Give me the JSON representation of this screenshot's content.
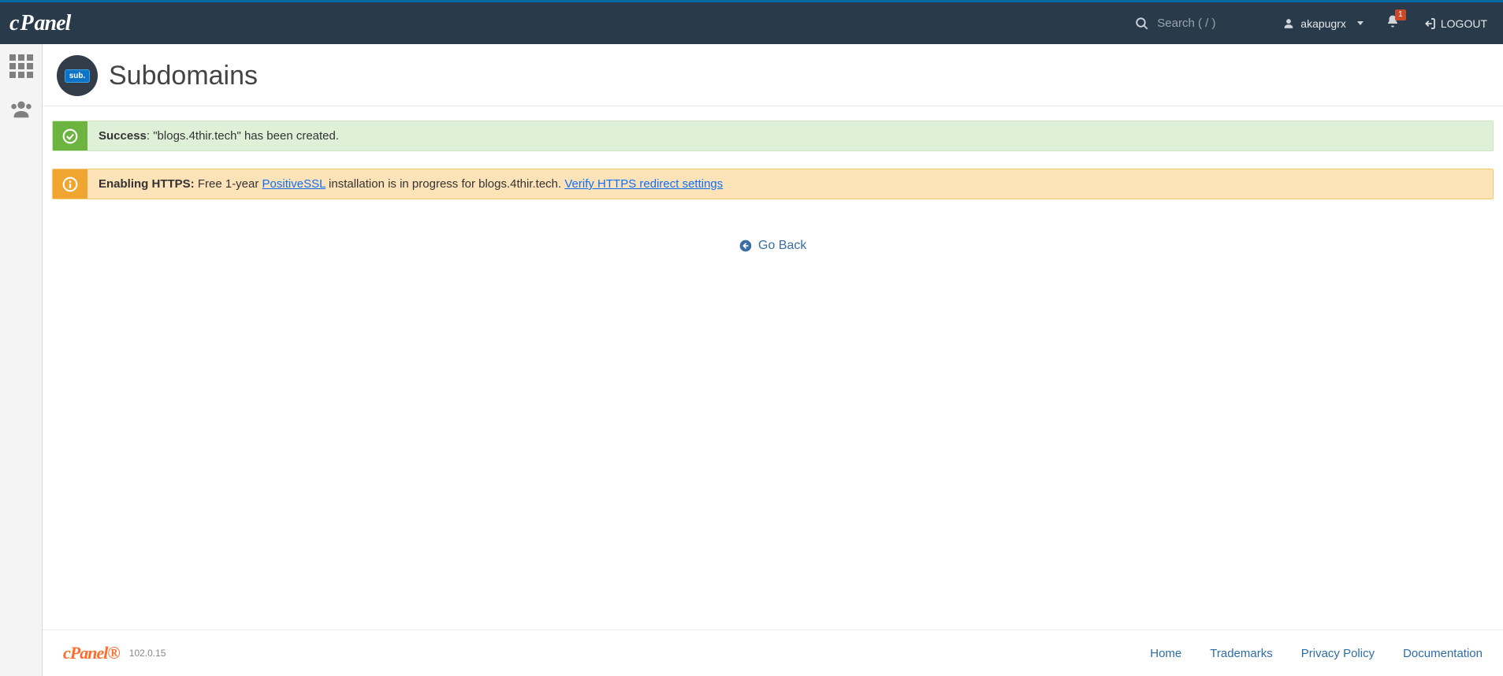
{
  "header": {
    "search_placeholder": "Search ( / )",
    "username": "akapugrx",
    "notification_count": "1",
    "logout_label": "LOGOUT"
  },
  "page": {
    "title": "Subdomains",
    "icon_chip": "sub."
  },
  "alerts": {
    "success_title": "Success",
    "success_message": ": \"blogs.4thir.tech\" has been created.",
    "info_title": "Enabling HTTPS:",
    "info_prefix": " Free 1-year ",
    "info_link1": "PositiveSSL",
    "info_mid": " installation is in progress for blogs.4thir.tech. ",
    "info_link2": "Verify HTTPS redirect settings"
  },
  "goback_label": "Go Back",
  "footer": {
    "version": "102.0.15",
    "links": {
      "home": "Home",
      "trademarks": "Trademarks",
      "privacy": "Privacy Policy",
      "docs": "Documentation"
    }
  }
}
